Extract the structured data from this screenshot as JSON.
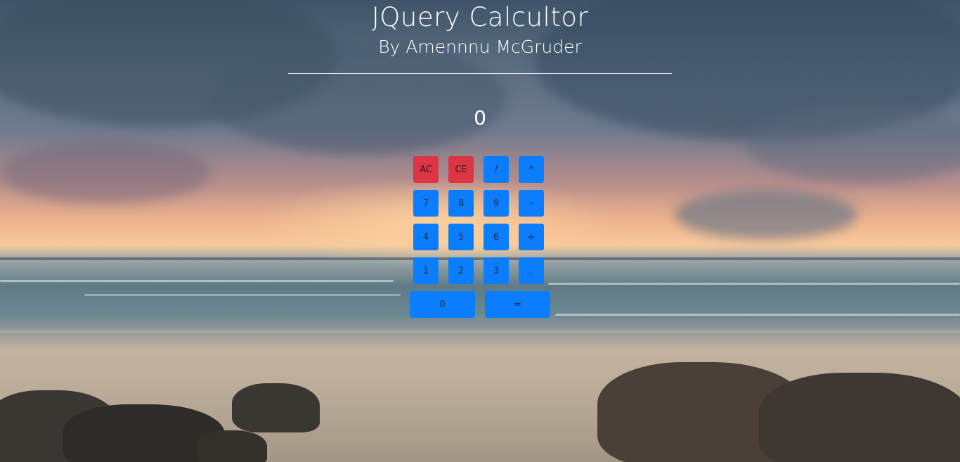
{
  "header": {
    "title": "JQuery Calcultor",
    "subtitle": "By Amennnu McGruder"
  },
  "display": {
    "value": "0"
  },
  "colors": {
    "primary": "#0b7dff",
    "danger": "#dc3545",
    "text": "#ffffff"
  },
  "keys": {
    "ac": "AC",
    "ce": "CE",
    "divide": "/",
    "multiply": "*",
    "seven": "7",
    "eight": "8",
    "nine": "9",
    "minus": "-",
    "four": "4",
    "five": "5",
    "six": "6",
    "plus": "+",
    "one": "1",
    "two": "2",
    "three": "3",
    "decimal": ".",
    "zero": "0",
    "equals": "="
  }
}
